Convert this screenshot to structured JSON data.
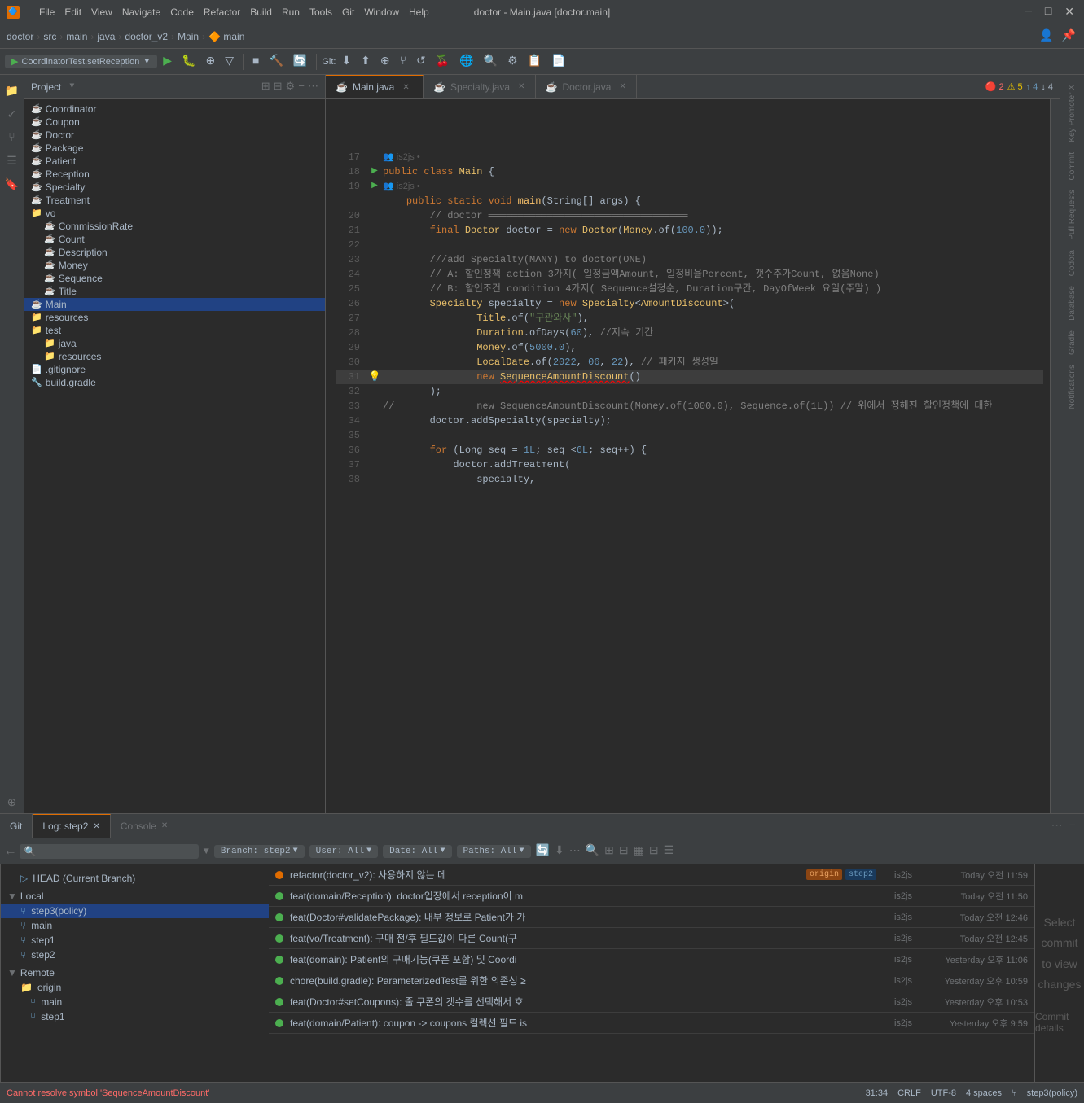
{
  "app": {
    "title": "doctor - Main.java [doctor.main]",
    "icon": "🔷"
  },
  "menu": {
    "items": [
      "File",
      "Edit",
      "View",
      "Navigate",
      "Code",
      "Refactor",
      "Build",
      "Run",
      "Tools",
      "Git",
      "Window",
      "Help"
    ]
  },
  "breadcrumb": {
    "items": [
      "doctor",
      "src",
      "main",
      "java",
      "doctor_v2",
      "Main",
      "main"
    ]
  },
  "tabs": [
    {
      "label": "Main.java",
      "active": true,
      "modified": false
    },
    {
      "label": "Specialty.java",
      "active": false,
      "modified": false
    },
    {
      "label": "Doctor.java",
      "active": false,
      "modified": false
    }
  ],
  "editor": {
    "error_count": "2",
    "warn_count": "5",
    "up_count": "4",
    "down_count": "4",
    "lines": [
      {
        "num": 17,
        "content": ""
      },
      {
        "num": 18,
        "content": "public class Main {",
        "run": true
      },
      {
        "num": 19,
        "content": "    public static void main(String[] args) {",
        "run": true
      },
      {
        "num": 20,
        "content": "        // doctor ═══════════════════════════════"
      },
      {
        "num": 21,
        "content": "        final Doctor doctor = new Doctor(Money.of(100.0));"
      },
      {
        "num": 22,
        "content": ""
      },
      {
        "num": 23,
        "content": "        ///add Specialty(MANY) to doctor(ONE)"
      },
      {
        "num": 24,
        "content": "        // A: 할인정책 action 3가지( 일정금액Amount, 일정비율Percent, 갯수추가Count, 없음None)"
      },
      {
        "num": 25,
        "content": "        // B: 할인조건 condition 4가지( Sequence설정순, Duration구간, DayOfWeek 요일(주말) )"
      },
      {
        "num": 26,
        "content": "        Specialty specialty = new Specialty<AmountDiscount>("
      },
      {
        "num": 27,
        "content": "                Title.of(\"구관와사\"),"
      },
      {
        "num": 28,
        "content": "                Duration.ofDays(60), //지속 기간"
      },
      {
        "num": 29,
        "content": "                Money.of(5000.0),"
      },
      {
        "num": 30,
        "content": "                LocalDate.of(2022, 06, 22), // 패키지 생성일"
      },
      {
        "num": 31,
        "content": "                new SequenceAmountDiscount()",
        "warn": true,
        "error": true
      },
      {
        "num": 32,
        "content": "        );"
      },
      {
        "num": 33,
        "content": "//              new SequenceAmountDiscount(Money.of(1000.0), Sequence.of(1L)) // 위에서 정해진 할인정책에 대한"
      },
      {
        "num": 34,
        "content": "        doctor.addSpecialty(specialty);"
      },
      {
        "num": 35,
        "content": ""
      },
      {
        "num": 36,
        "content": "        for (Long seq = 1L; seq <6L; seq++) {"
      },
      {
        "num": 37,
        "content": "            doctor.addTreatment("
      },
      {
        "num": 38,
        "content": "                specialty,"
      }
    ],
    "author_annotations": [
      {
        "line": 17,
        "text": "👥 is2js •"
      },
      {
        "line": 19,
        "text": "👥 is2js •"
      }
    ]
  },
  "project_tree": {
    "title": "Project",
    "items": [
      {
        "name": "Coordinator",
        "type": "class",
        "indent": 0
      },
      {
        "name": "Coupon",
        "type": "class",
        "indent": 0
      },
      {
        "name": "Doctor",
        "type": "class",
        "indent": 0
      },
      {
        "name": "Package",
        "type": "class",
        "indent": 0
      },
      {
        "name": "Patient",
        "type": "class",
        "indent": 0
      },
      {
        "name": "Reception",
        "type": "class",
        "indent": 0
      },
      {
        "name": "Specialty",
        "type": "class",
        "indent": 0
      },
      {
        "name": "Treatment",
        "type": "class",
        "indent": 0
      },
      {
        "name": "vo",
        "type": "folder",
        "indent": 0
      },
      {
        "name": "CommissionRate",
        "type": "class",
        "indent": 1
      },
      {
        "name": "Count",
        "type": "class",
        "indent": 1
      },
      {
        "name": "Description",
        "type": "class",
        "indent": 1
      },
      {
        "name": "Money",
        "type": "class",
        "indent": 1
      },
      {
        "name": "Sequence",
        "type": "class",
        "indent": 1
      },
      {
        "name": "Title",
        "type": "class",
        "indent": 1
      },
      {
        "name": "Main",
        "type": "class",
        "indent": 0,
        "selected": true
      },
      {
        "name": "resources",
        "type": "folder_res",
        "indent": 0
      },
      {
        "name": "test",
        "type": "folder",
        "indent": 0
      },
      {
        "name": "java",
        "type": "folder_test",
        "indent": 1
      },
      {
        "name": "resources",
        "type": "folder_res",
        "indent": 1
      },
      {
        "name": ".gitignore",
        "type": "gitignore",
        "indent": 0
      },
      {
        "name": "build.gradle",
        "type": "gradle",
        "indent": 0
      }
    ]
  },
  "bottom": {
    "tabs": [
      "Git",
      "Log: step2",
      "Console"
    ],
    "active_tab": 1,
    "toolbar": {
      "search_placeholder": "🔍",
      "branch_label": "Branch: step2",
      "user_label": "User: All",
      "date_label": "Date: All",
      "paths_label": "Paths: All"
    },
    "log_entries": [
      {
        "msg": "refactor(doctor_v2): 사용하지 않는 메",
        "tags": [
          "origin",
          "step2"
        ],
        "author": "is2js",
        "date": "Today 오전 11:59",
        "selected": false
      },
      {
        "msg": "feat(domain/Reception): doctor입장에서 reception이 m",
        "tags": [],
        "author": "is2js",
        "date": "Today 오전 11:50",
        "selected": false
      },
      {
        "msg": "feat(Doctor#validatePackage): 내부 정보로 Patient가 가",
        "tags": [],
        "author": "is2js",
        "date": "Today 오전 12:46",
        "selected": false
      },
      {
        "msg": "feat(vo/Treatment): 구매 전/후 필드값이 다른 Count(구",
        "tags": [],
        "author": "is2js",
        "date": "Today 오전 12:45",
        "selected": false
      },
      {
        "msg": "feat(domain): Patient의 구매기능(쿠폰 포함) 및 Coordi",
        "tags": [],
        "author": "is2js",
        "date": "Yesterday 오후 11:06",
        "selected": false
      },
      {
        "msg": "chore(build.gradle): ParameterizedTest를 위한 의존성 ≥",
        "tags": [],
        "author": "is2js",
        "date": "Yesterday 오후 10:59",
        "selected": false
      },
      {
        "msg": "feat(Doctor#setCoupons): 줄 쿠폰의 갯수를 선택해서 호",
        "tags": [],
        "author": "is2js",
        "date": "Yesterday 오후 10:53",
        "selected": false
      },
      {
        "msg": "feat(domain/Patient): coupon -> coupons 컬렉션 필드 is",
        "tags": [],
        "author": "is2js",
        "date": "Yesterday 오후 9:59",
        "selected": false
      }
    ],
    "no_commit_text": "Select commit to view changes",
    "commit_details_label": "Commit details",
    "branches": {
      "head": "HEAD (Current Branch)",
      "local_label": "Local",
      "local_branches": [
        {
          "name": "step3(policy)",
          "selected": true
        },
        {
          "name": "main",
          "selected": false
        },
        {
          "name": "step1",
          "selected": false
        },
        {
          "name": "step2",
          "selected": false
        }
      ],
      "remote_label": "Remote",
      "remote_groups": [
        {
          "name": "origin",
          "branches": [
            {
              "name": "main"
            },
            {
              "name": "step1"
            }
          ]
        }
      ]
    }
  },
  "status_bar": {
    "error": "Cannot resolve symbol 'SequenceAmountDiscount'",
    "position": "31:34",
    "line_sep": "CRLF",
    "encoding": "UTF-8",
    "indent": "4 spaces",
    "branch": "step3(policy)"
  },
  "run_config": {
    "label": "CoordinatorTest.setReception"
  },
  "right_panels": [
    "Key Promoter X",
    "Commit",
    "Pull Requests",
    "Codota",
    "Database",
    "Gradle",
    "Notifications"
  ],
  "left_panels": [
    "Project",
    "Commit",
    "Pull Requests",
    "Structure",
    "Bookmarks"
  ]
}
